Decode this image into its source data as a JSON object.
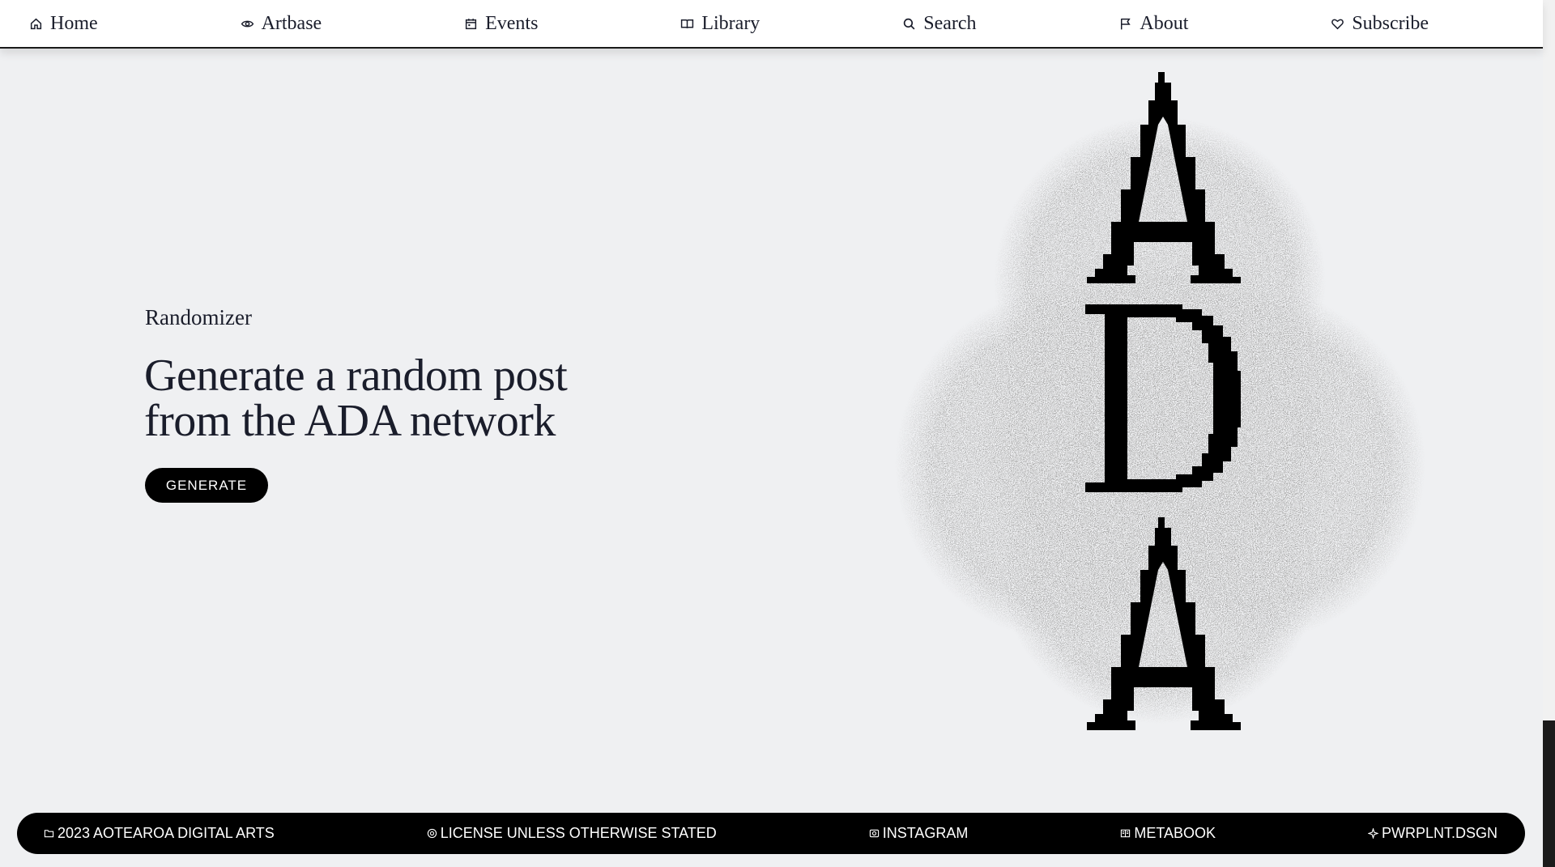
{
  "nav": {
    "items": [
      {
        "label": "Home",
        "icon": "home-icon"
      },
      {
        "label": "Artbase",
        "icon": "eye-icon"
      },
      {
        "label": "Events",
        "icon": "calendar-icon"
      },
      {
        "label": "Library",
        "icon": "book-icon"
      },
      {
        "label": "Search",
        "icon": "search-icon"
      },
      {
        "label": "About",
        "icon": "flag-icon"
      },
      {
        "label": "Subscribe",
        "icon": "heart-icon"
      }
    ]
  },
  "hero": {
    "eyebrow": "Randomizer",
    "title_line1": "Generate a random post",
    "title_line2": "from the ADA network",
    "button_label": "GENERATE"
  },
  "logo": {
    "letters": [
      "A",
      "D",
      "A"
    ],
    "icon": "ada-logo-icon"
  },
  "footer": {
    "items": [
      {
        "label": "2023 AOTEAROA DIGITAL ARTS",
        "icon": "folder-icon"
      },
      {
        "label": "LICENSE UNLESS OTHERWISE STATED",
        "icon": "badge-icon"
      },
      {
        "label": "INSTAGRAM",
        "icon": "camera-icon"
      },
      {
        "label": "METABOOK",
        "icon": "book-icon"
      },
      {
        "label": "PWRPLNT.DSGN",
        "icon": "sparkle-icon"
      }
    ]
  },
  "colors": {
    "background": "#eff0f2",
    "text": "#1a1d2b",
    "button": "#000000",
    "footer": "#000000"
  }
}
